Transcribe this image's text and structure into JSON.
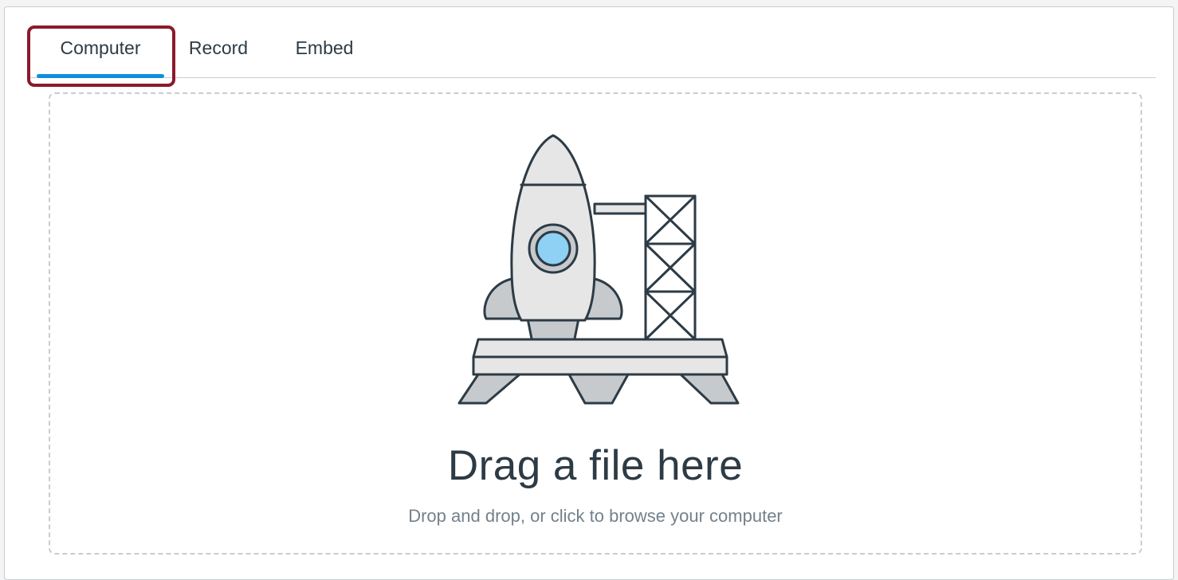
{
  "tabs": [
    {
      "label": "Computer",
      "active": true
    },
    {
      "label": "Record",
      "active": false
    },
    {
      "label": "Embed",
      "active": false
    }
  ],
  "dropzone": {
    "title": "Drag a file here",
    "subtitle": "Drop and drop, or click to browse your computer",
    "illustration": "rocket-launch-pad-icon"
  },
  "colors": {
    "active_tab_underline": "#0d8fdb",
    "highlight_border": "#8b1a2b",
    "text_primary": "#2d3b45",
    "text_secondary": "#73818c",
    "border": "#c7cdd1",
    "porthole": "#8fd0f5"
  }
}
